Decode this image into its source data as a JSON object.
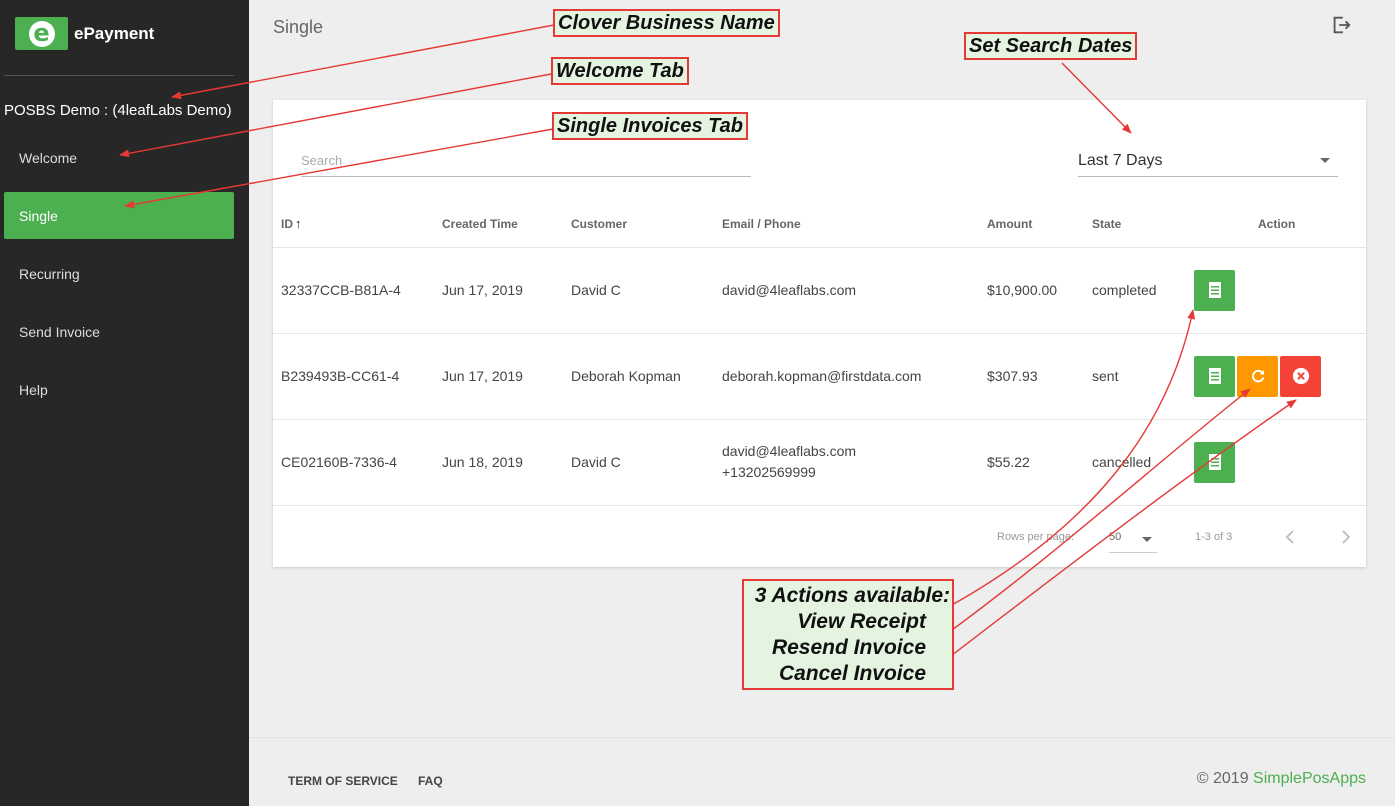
{
  "app": {
    "logo_letter": "e",
    "name": "ePayment"
  },
  "sidebar": {
    "business_name": "POSBS Demo : (4leafLabs Demo)",
    "items": [
      {
        "label": "Welcome",
        "active": false
      },
      {
        "label": "Single",
        "active": true
      },
      {
        "label": "Recurring",
        "active": false
      },
      {
        "label": "Send Invoice",
        "active": false
      },
      {
        "label": "Help",
        "active": false
      }
    ]
  },
  "header": {
    "title": "Single",
    "logout_icon": "logout-icon"
  },
  "filters": {
    "search_placeholder": "Search",
    "date_range": "Last 7 Days"
  },
  "table": {
    "columns": {
      "id": "ID",
      "created": "Created Time",
      "customer": "Customer",
      "email": "Email / Phone",
      "amount": "Amount",
      "state": "State",
      "action": "Action"
    },
    "sort_icon": "↑",
    "rows": [
      {
        "id": "32337CCB-B81A-4",
        "created": "Jun 17, 2019",
        "customer": "David C",
        "email": "david@4leaflabs.com",
        "phone": "",
        "amount": "$10,900.00",
        "state": "completed"
      },
      {
        "id": "B239493B-CC61-4",
        "created": "Jun 17, 2019",
        "customer": "Deborah Kopman",
        "email": "deborah.kopman@firstdata.com",
        "phone": "",
        "amount": "$307.93",
        "state": "sent"
      },
      {
        "id": "CE02160B-7336-4",
        "created": "Jun 18, 2019",
        "customer": "David C",
        "email": "david@4leaflabs.com",
        "phone": "+13202569999",
        "amount": "$55.22",
        "state": "cancelled"
      }
    ]
  },
  "pagination": {
    "rows_per_page_label": "Rows per page:",
    "rows_per_page": "50",
    "range": "1-3 of 3",
    "prev": "‹",
    "next": "›"
  },
  "footer": {
    "terms": "TERM OF SERVICE",
    "faq": "FAQ",
    "copyright": "© 2019 ",
    "company": "SimplePosApps"
  },
  "annotations": {
    "business_name": "Clover Business Name",
    "welcome_tab": "Welcome Tab",
    "single_tab": "Single Invoices Tab",
    "search_dates": "Set Search Dates",
    "actions": [
      "3 Actions available:",
      "View Receipt",
      "Resend Invoice",
      "Cancel Invoice"
    ]
  },
  "colors": {
    "accent": "#4caf50",
    "resend": "#ff9800",
    "cancel": "#f44336",
    "annotation_border": "#e53935",
    "annotation_bg": "#e5f4e1",
    "sidebar_bg": "#272727"
  }
}
